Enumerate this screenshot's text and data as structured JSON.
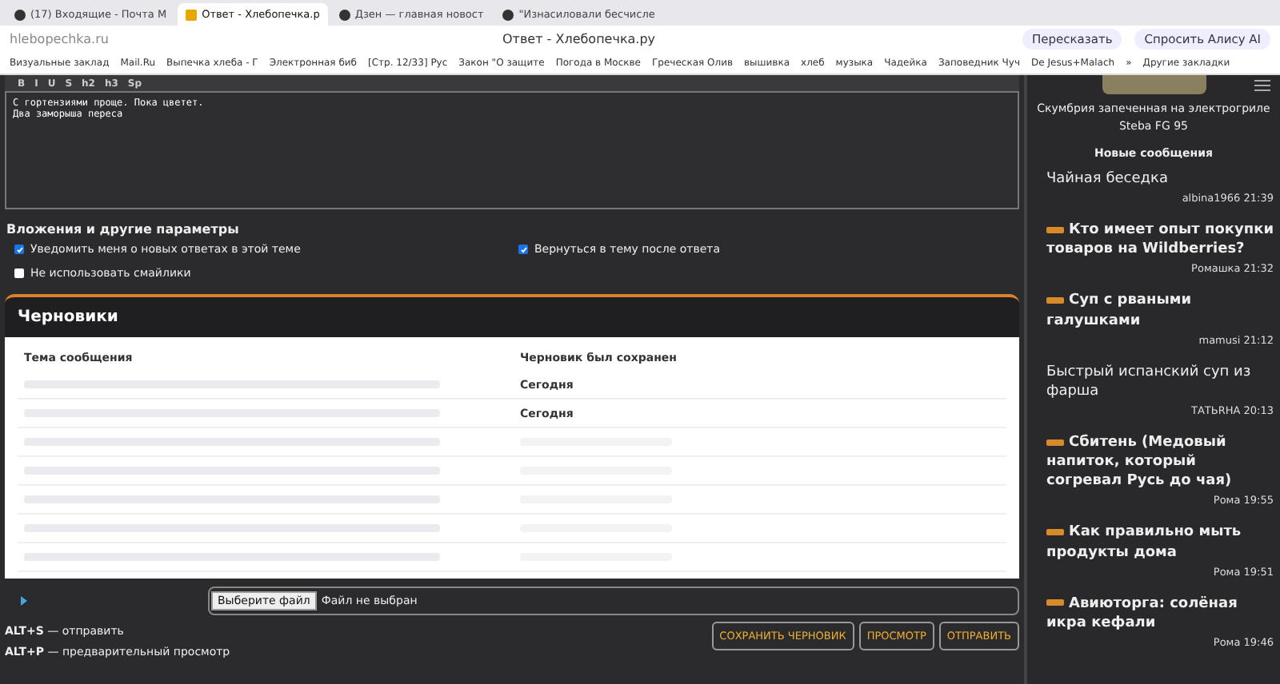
{
  "browser": {
    "tabs": [
      {
        "label": "(17) Входящие - Почта M",
        "selected": false
      },
      {
        "label": "Ответ - Хлебопечка.р",
        "selected": true
      },
      {
        "label": "Дзен — главная новост",
        "selected": false
      },
      {
        "label": "\"Изнасиловали бесчисле",
        "selected": false
      }
    ],
    "address": "hlebopechka.ru",
    "page_title": "Ответ - Хлебопечка.ру",
    "actions": [
      "Пересказать",
      "Спросить Алису AI"
    ],
    "bookmarks": [
      "Визуальные заклад",
      "Mail.Ru",
      "Выпечка хлеба - Г",
      "Электронная биб",
      "[Стр. 12/33] Рус",
      "Закон \"О защите",
      "Погода в Москве",
      "Греческая Олив",
      "вышивка",
      "хлеб",
      "музыка",
      "Чадейка",
      "Заповедник Чуч",
      "De Jesus+Malach",
      "»",
      "Другие закладки"
    ]
  },
  "editor": {
    "toolbar": [
      "B",
      "I",
      "U",
      "S",
      "h2",
      "h3",
      "Sp"
    ],
    "lines": [
      "С гортензиями проще. Пока цветет.",
      "Два заморыша переса"
    ]
  },
  "options": {
    "title": "Вложения и другие параметры",
    "checkboxes": [
      {
        "label": "Уведомить меня о новых ответах в этой теме",
        "checked": true
      },
      {
        "label": "Вернуться в тему после ответа",
        "checked": true
      },
      {
        "label": "Не использовать смайлики",
        "checked": false
      }
    ]
  },
  "drafts": {
    "title": "Черновики",
    "columns": [
      "Тема сообщения",
      "Черновик был сохранен"
    ],
    "rows": [
      {
        "saved": "Сегодня"
      },
      {
        "saved": "Сегодня"
      },
      {},
      {},
      {},
      {},
      {}
    ]
  },
  "attachment": {
    "button": "Выберите файл",
    "status": "Файл не выбран"
  },
  "hints": [
    "**ALT+S** — отправить",
    "**ALT+P** — предварительный просмотр"
  ],
  "buttons": [
    "СОХРАНИТЬ ЧЕРНОВИК",
    "ПРОСМОТР",
    "ОТПРАВИТЬ"
  ],
  "sidebar": {
    "caption": "Скумбрия запеченная на электрогриле Steba FG 95",
    "heading": "Новые сообщения",
    "posts": [
      {
        "title": "Чайная беседка",
        "meta": "albina1966 21:39",
        "is_new": false
      },
      {
        "title": "Кто имеет опыт покупки товаров на Wildberries?",
        "meta": "Ромашка 21:32",
        "is_new": true
      },
      {
        "title": "Суп с рваными галушками",
        "meta": "mamusi 21:12",
        "is_new": true
      },
      {
        "title": "Быстрый испанский суп из фарша",
        "meta": "ТАТЬRНА 20:13",
        "is_new": false
      },
      {
        "title": "Сбитень (Медовый напиток, который согревал Русь до чая)",
        "meta": "Рома 19:55",
        "is_new": true
      },
      {
        "title": "Как правильно мыть продукты дома",
        "meta": "Рома 19:51",
        "is_new": true
      },
      {
        "title": "Авиюторга: солёная икра кефали",
        "meta": "Рома 19:46",
        "is_new": true
      }
    ]
  }
}
